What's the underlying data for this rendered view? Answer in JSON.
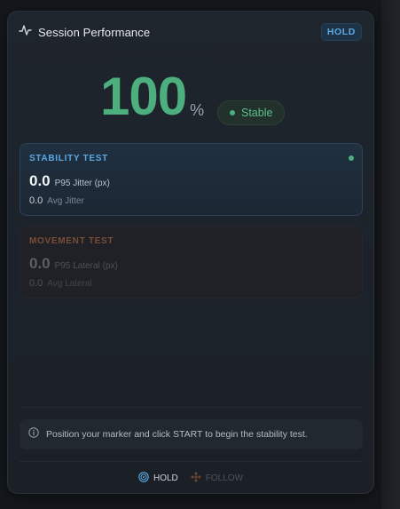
{
  "header": {
    "title": "Session Performance",
    "mode_badge": "HOLD",
    "icon": "pulse-icon"
  },
  "score": {
    "value": "100",
    "unit": "%",
    "status": "Stable",
    "color": "#4caf7d"
  },
  "tests": {
    "stability": {
      "title": "STABILITY TEST",
      "primary_value": "0.0",
      "primary_label": "P95 Jitter (px)",
      "secondary_value": "0.0",
      "secondary_label": "Avg Jitter",
      "active": true,
      "accent": "#5aa9e6"
    },
    "movement": {
      "title": "MOVEMENT TEST",
      "primary_value": "0.0",
      "primary_label": "P95 Lateral (px)",
      "secondary_value": "0.0",
      "secondary_label": "Avg Lateral",
      "active": false,
      "accent": "#7a4d36"
    }
  },
  "info": {
    "icon": "info-icon",
    "text": "Position your marker and click START to begin the stability test."
  },
  "footer": {
    "hold_label": "HOLD",
    "follow_label": "FOLLOW",
    "hold_icon": "target-icon",
    "follow_icon": "move-arrows-icon"
  }
}
